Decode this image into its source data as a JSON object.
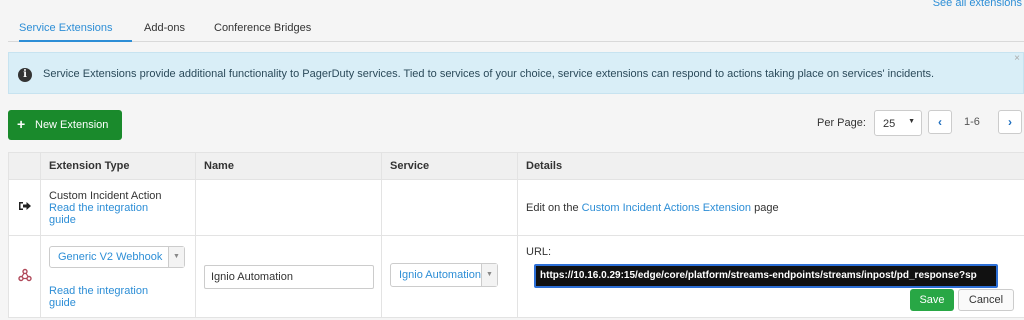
{
  "header": {
    "see_all_link": "See all extensions"
  },
  "tabs": [
    {
      "label": "Service Extensions",
      "active": true
    },
    {
      "label": "Add-ons",
      "active": false
    },
    {
      "label": "Conference Bridges",
      "active": false
    }
  ],
  "alert": {
    "message": "Service Extensions provide additional functionality to PagerDuty services. Tied to services of your choice, service extensions can respond to actions taking place on services' incidents.",
    "close": "×"
  },
  "toolbar": {
    "new_extension_label": "New Extension",
    "per_page_label": "Per Page:",
    "per_page_value": "25",
    "page_range": "1-6"
  },
  "table": {
    "columns": [
      "Extension Type",
      "Name",
      "Service",
      "Details"
    ],
    "rows": [
      {
        "type_title": "Custom Incident Action",
        "guide_link": "Read the integration guide",
        "name": "",
        "service": "",
        "details_prefix": "Edit on the ",
        "details_link": "Custom Incident Actions Extension",
        "details_suffix": " page"
      },
      {
        "type_select": "Generic V2 Webhook",
        "guide_link": "Read the integration guide",
        "name_value": "Ignio Automation",
        "service_select": "Ignio Automation",
        "url_label": "URL:",
        "url_value": "https://10.16.0.29:15/edge/core/platform/streams-endpoints/streams/inpost/pd_response?sp",
        "save_label": "Save",
        "cancel_label": "Cancel"
      }
    ]
  },
  "colors": {
    "accent": "#2d8ed6",
    "primary_green": "#1a8a2c",
    "save_green": "#28a745",
    "alert_bg": "#d9eef7"
  }
}
